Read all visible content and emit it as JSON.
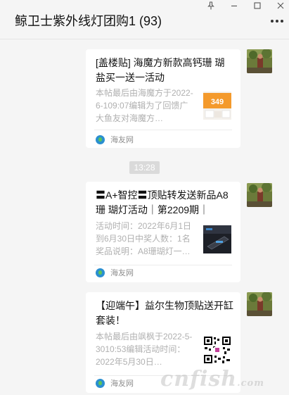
{
  "window": {
    "title": "鲸卫士紫外线灯团购1 (93)",
    "controls": [
      "pin-icon",
      "minimize-icon",
      "maximize-icon",
      "close-icon"
    ]
  },
  "messages": [
    {
      "title": "[盖楼贴] 海魔方新款高钙珊 瑚盐买一送一活动",
      "desc": "本帖最后由海魔方于2022-6-109:07编辑为了回馈广大鱼友对海魔方…",
      "source": "海友网",
      "thumb_text": "349"
    },
    {
      "time": "13:28"
    },
    {
      "title": "〓A+智控〓顶贴转发送新品A8珊 瑚灯活动｜第2209期｜",
      "desc": "活动时间：2022年6月1日到6月30日中奖人数：1名奖品说明：A8珊瑚灯一…",
      "source": "海友网"
    },
    {
      "title": "【迎端午】益尔生物顶贴送开缸套装！",
      "desc": "本帖最后由飒枫于2022-5-3010:53编辑活动时间：2022年5月30日…",
      "source": "海友网"
    }
  ],
  "watermark": {
    "main": "cnfish",
    "suffix": ".com"
  },
  "colors": {
    "background": "#f5f5f5",
    "card": "#ffffff",
    "time_pill": "#dadada",
    "source_logo": "#2a8fd0"
  }
}
